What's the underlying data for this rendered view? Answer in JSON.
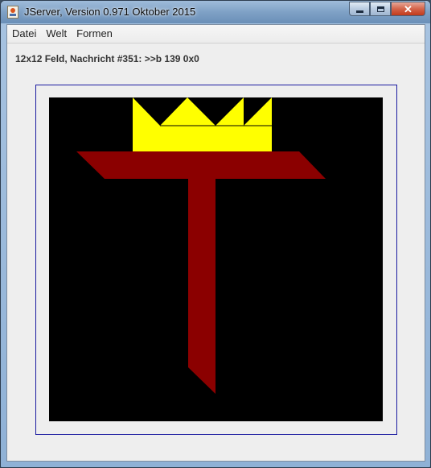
{
  "window": {
    "title": "JServer, Version 0.971 Oktober 2015",
    "icon": "java-app-icon",
    "controls": {
      "minimize_glyph": "",
      "maximize_glyph": "",
      "close_glyph": "✕"
    }
  },
  "menu": {
    "items": [
      {
        "label": "Datei"
      },
      {
        "label": "Welt"
      },
      {
        "label": "Formen"
      }
    ]
  },
  "status": {
    "text": "12x12 Feld, Nachricht #351: >>b 139 0x0"
  },
  "board": {
    "grid": "12x12",
    "background_color": "#000000",
    "shapes": [
      {
        "name": "crown",
        "color": "#ffff00"
      },
      {
        "name": "t-bar",
        "color": "#8b0000"
      },
      {
        "name": "t-stem",
        "color": "#8b0000"
      }
    ]
  },
  "colors": {
    "frame_border": "#1a1aa0",
    "panel_background": "#eeeeee"
  }
}
